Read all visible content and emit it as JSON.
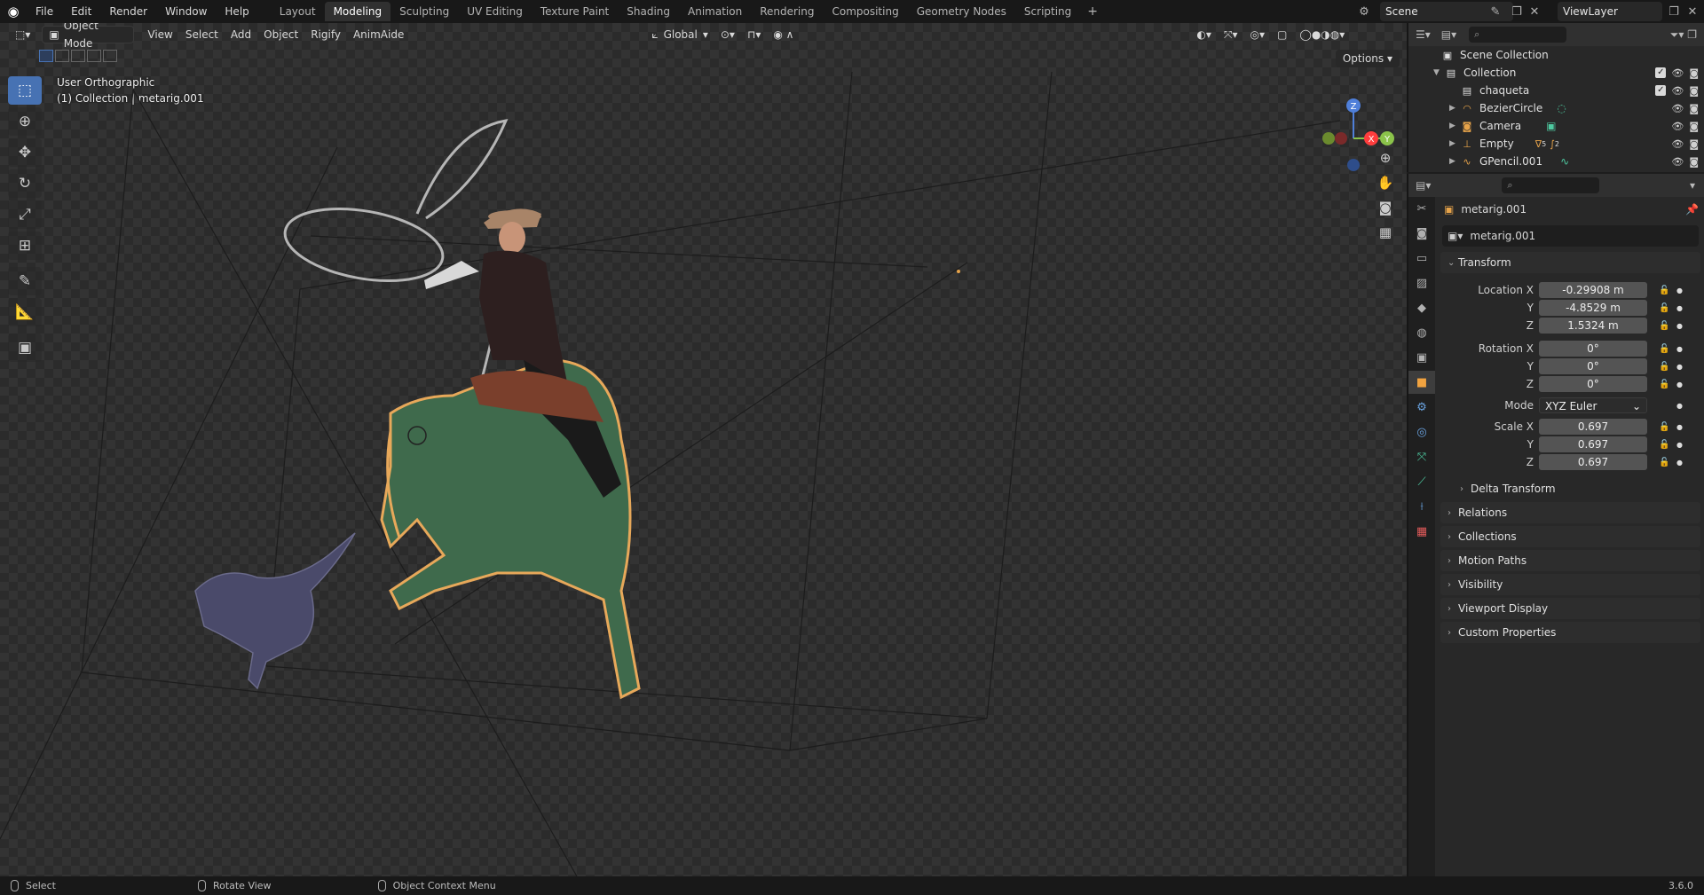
{
  "menu": {
    "items": [
      "File",
      "Edit",
      "Render",
      "Window",
      "Help"
    ]
  },
  "workspaces": {
    "tabs": [
      "Layout",
      "Modeling",
      "Sculpting",
      "UV Editing",
      "Texture Paint",
      "Shading",
      "Animation",
      "Rendering",
      "Compositing",
      "Geometry Nodes",
      "Scripting"
    ],
    "active": "Modeling",
    "add_label": "+"
  },
  "scene": {
    "name": "Scene",
    "view_layer": "ViewLayer"
  },
  "viewport_header": {
    "mode": "Object Mode",
    "menus": [
      "View",
      "Select",
      "Add",
      "Object",
      "Rigify",
      "AnimAide"
    ],
    "orientation": "Global",
    "options_label": "Options"
  },
  "viewport": {
    "view_name": "User Orthographic",
    "collection_info": "(1) Collection | metarig.001",
    "gizmo": {
      "x": "X",
      "y": "Y",
      "z": "Z"
    }
  },
  "toolbar": {
    "tools": [
      "select-box-icon",
      "cursor-icon",
      "move-icon",
      "rotate-icon",
      "scale-icon",
      "transform-icon",
      "annotate-icon",
      "measure-icon",
      "add-cube-icon"
    ]
  },
  "outliner": {
    "root": "Scene Collection",
    "items": [
      {
        "name": "Collection",
        "icon": "collection-icon",
        "level": 0
      },
      {
        "name": "chaqueta",
        "icon": "collection-icon",
        "level": 1
      },
      {
        "name": "BezierCircle",
        "icon": "curve-icon",
        "level": 1
      },
      {
        "name": "Camera",
        "icon": "camera-icon",
        "level": 1
      },
      {
        "name": "Empty",
        "icon": "empty-icon",
        "level": 1
      },
      {
        "name": "GPencil.001",
        "icon": "gpencil-icon",
        "level": 1
      }
    ],
    "empty_badge": "5",
    "empty_badge2": "2"
  },
  "properties": {
    "object_name": "metarig.001",
    "datablock_name": "metarig.001",
    "transform_label": "Transform",
    "location": {
      "label": "Location X",
      "x": "-0.29908 m",
      "y": "-4.8529 m",
      "z": "1.5324 m"
    },
    "rotation": {
      "label": "Rotation X",
      "x": "0°",
      "y": "0°",
      "z": "0°"
    },
    "mode": {
      "label": "Mode",
      "value": "XYZ Euler"
    },
    "scale": {
      "label": "Scale X",
      "x": "0.697",
      "y": "0.697",
      "z": "0.697"
    },
    "axis_y": "Y",
    "axis_z": "Z",
    "sections": [
      "Delta Transform",
      "Relations",
      "Collections",
      "Motion Paths",
      "Visibility",
      "Viewport Display",
      "Custom Properties"
    ]
  },
  "statusbar": {
    "select": "Select",
    "rotate": "Rotate View",
    "context": "Object Context Menu",
    "version": "3.6.0"
  },
  "colors": {
    "accent": "#4772b3",
    "active_tab": "#f1a340"
  }
}
